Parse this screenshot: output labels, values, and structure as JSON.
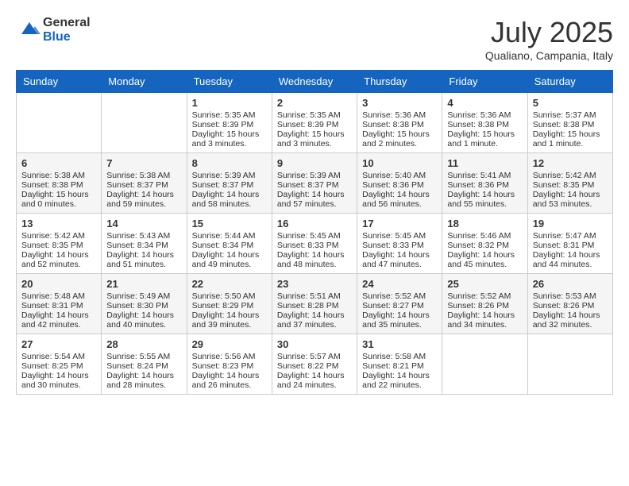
{
  "logo": {
    "general": "General",
    "blue": "Blue"
  },
  "header": {
    "month": "July 2025",
    "location": "Qualiano, Campania, Italy"
  },
  "weekdays": [
    "Sunday",
    "Monday",
    "Tuesday",
    "Wednesday",
    "Thursday",
    "Friday",
    "Saturday"
  ],
  "weeks": [
    [
      {
        "day": "",
        "info": ""
      },
      {
        "day": "",
        "info": ""
      },
      {
        "day": "1",
        "sunrise": "5:35 AM",
        "sunset": "8:39 PM",
        "daylight": "15 hours and 3 minutes."
      },
      {
        "day": "2",
        "sunrise": "5:35 AM",
        "sunset": "8:39 PM",
        "daylight": "15 hours and 3 minutes."
      },
      {
        "day": "3",
        "sunrise": "5:36 AM",
        "sunset": "8:38 PM",
        "daylight": "15 hours and 2 minutes."
      },
      {
        "day": "4",
        "sunrise": "5:36 AM",
        "sunset": "8:38 PM",
        "daylight": "15 hours and 1 minute."
      },
      {
        "day": "5",
        "sunrise": "5:37 AM",
        "sunset": "8:38 PM",
        "daylight": "15 hours and 1 minute."
      }
    ],
    [
      {
        "day": "6",
        "sunrise": "5:38 AM",
        "sunset": "8:38 PM",
        "daylight": "15 hours and 0 minutes."
      },
      {
        "day": "7",
        "sunrise": "5:38 AM",
        "sunset": "8:37 PM",
        "daylight": "14 hours and 59 minutes."
      },
      {
        "day": "8",
        "sunrise": "5:39 AM",
        "sunset": "8:37 PM",
        "daylight": "14 hours and 58 minutes."
      },
      {
        "day": "9",
        "sunrise": "5:39 AM",
        "sunset": "8:37 PM",
        "daylight": "14 hours and 57 minutes."
      },
      {
        "day": "10",
        "sunrise": "5:40 AM",
        "sunset": "8:36 PM",
        "daylight": "14 hours and 56 minutes."
      },
      {
        "day": "11",
        "sunrise": "5:41 AM",
        "sunset": "8:36 PM",
        "daylight": "14 hours and 55 minutes."
      },
      {
        "day": "12",
        "sunrise": "5:42 AM",
        "sunset": "8:35 PM",
        "daylight": "14 hours and 53 minutes."
      }
    ],
    [
      {
        "day": "13",
        "sunrise": "5:42 AM",
        "sunset": "8:35 PM",
        "daylight": "14 hours and 52 minutes."
      },
      {
        "day": "14",
        "sunrise": "5:43 AM",
        "sunset": "8:34 PM",
        "daylight": "14 hours and 51 minutes."
      },
      {
        "day": "15",
        "sunrise": "5:44 AM",
        "sunset": "8:34 PM",
        "daylight": "14 hours and 49 minutes."
      },
      {
        "day": "16",
        "sunrise": "5:45 AM",
        "sunset": "8:33 PM",
        "daylight": "14 hours and 48 minutes."
      },
      {
        "day": "17",
        "sunrise": "5:45 AM",
        "sunset": "8:33 PM",
        "daylight": "14 hours and 47 minutes."
      },
      {
        "day": "18",
        "sunrise": "5:46 AM",
        "sunset": "8:32 PM",
        "daylight": "14 hours and 45 minutes."
      },
      {
        "day": "19",
        "sunrise": "5:47 AM",
        "sunset": "8:31 PM",
        "daylight": "14 hours and 44 minutes."
      }
    ],
    [
      {
        "day": "20",
        "sunrise": "5:48 AM",
        "sunset": "8:31 PM",
        "daylight": "14 hours and 42 minutes."
      },
      {
        "day": "21",
        "sunrise": "5:49 AM",
        "sunset": "8:30 PM",
        "daylight": "14 hours and 40 minutes."
      },
      {
        "day": "22",
        "sunrise": "5:50 AM",
        "sunset": "8:29 PM",
        "daylight": "14 hours and 39 minutes."
      },
      {
        "day": "23",
        "sunrise": "5:51 AM",
        "sunset": "8:28 PM",
        "daylight": "14 hours and 37 minutes."
      },
      {
        "day": "24",
        "sunrise": "5:52 AM",
        "sunset": "8:27 PM",
        "daylight": "14 hours and 35 minutes."
      },
      {
        "day": "25",
        "sunrise": "5:52 AM",
        "sunset": "8:26 PM",
        "daylight": "14 hours and 34 minutes."
      },
      {
        "day": "26",
        "sunrise": "5:53 AM",
        "sunset": "8:26 PM",
        "daylight": "14 hours and 32 minutes."
      }
    ],
    [
      {
        "day": "27",
        "sunrise": "5:54 AM",
        "sunset": "8:25 PM",
        "daylight": "14 hours and 30 minutes."
      },
      {
        "day": "28",
        "sunrise": "5:55 AM",
        "sunset": "8:24 PM",
        "daylight": "14 hours and 28 minutes."
      },
      {
        "day": "29",
        "sunrise": "5:56 AM",
        "sunset": "8:23 PM",
        "daylight": "14 hours and 26 minutes."
      },
      {
        "day": "30",
        "sunrise": "5:57 AM",
        "sunset": "8:22 PM",
        "daylight": "14 hours and 24 minutes."
      },
      {
        "day": "31",
        "sunrise": "5:58 AM",
        "sunset": "8:21 PM",
        "daylight": "14 hours and 22 minutes."
      },
      {
        "day": "",
        "info": ""
      },
      {
        "day": "",
        "info": ""
      }
    ]
  ]
}
